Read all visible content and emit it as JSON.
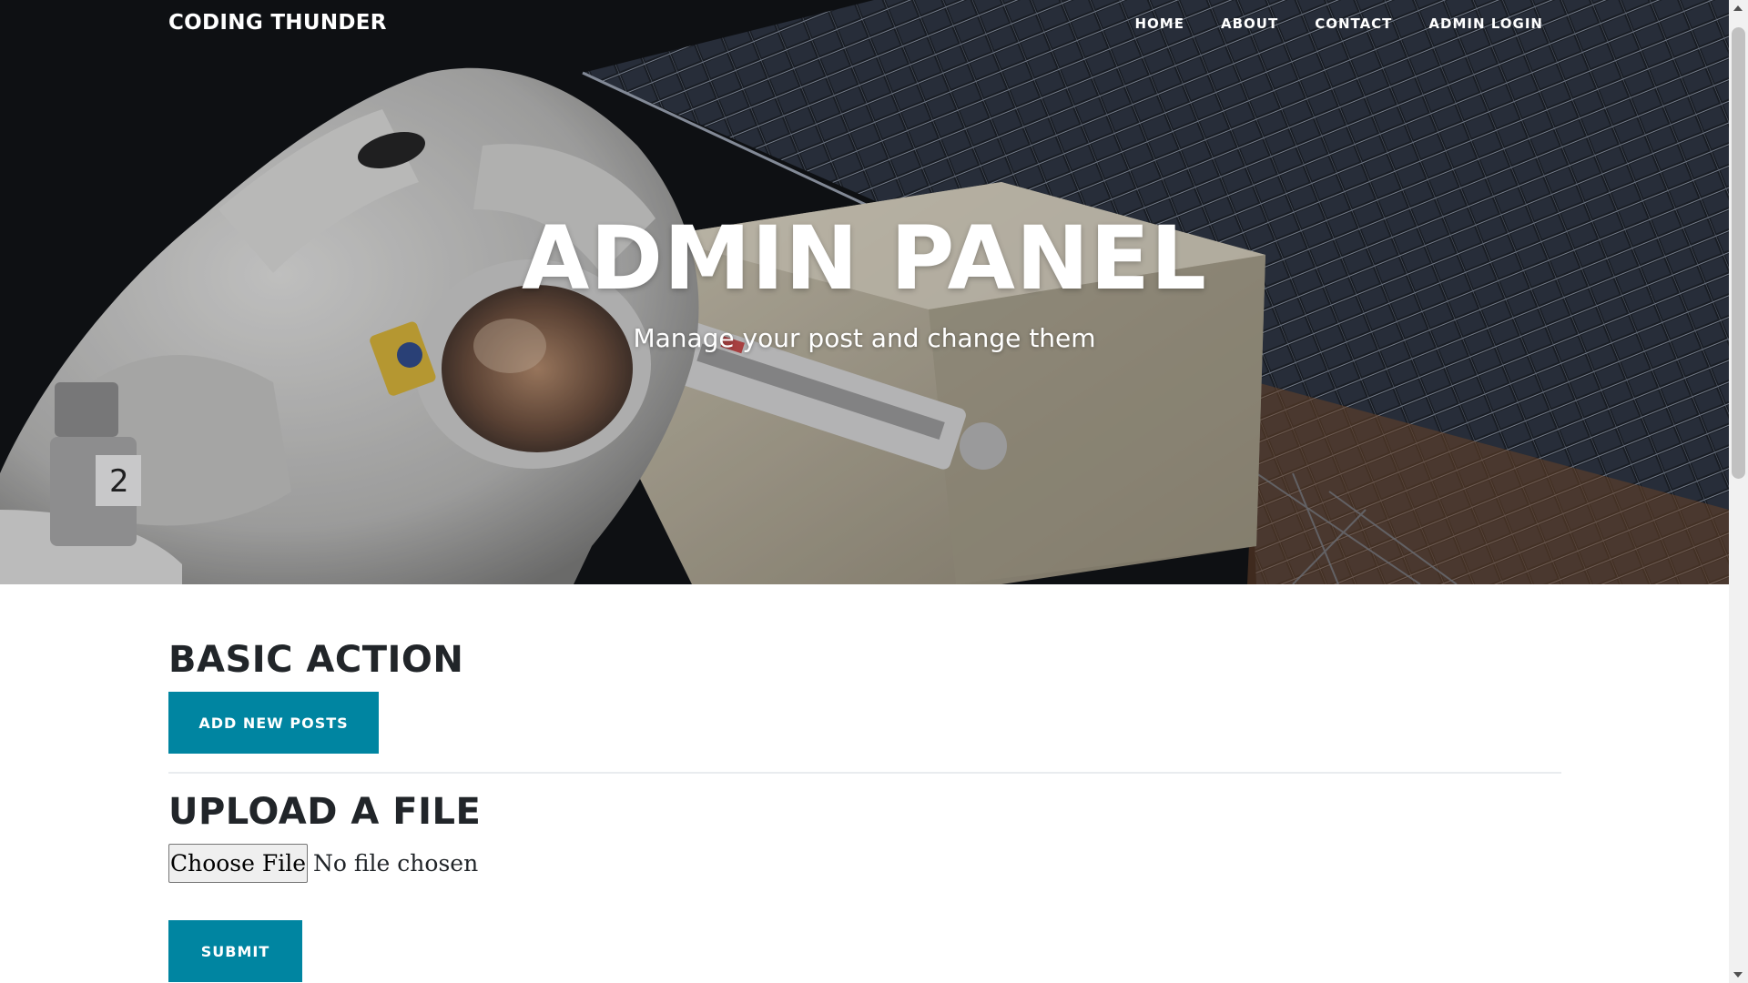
{
  "navbar": {
    "brand": "CODING THUNDER",
    "links": [
      {
        "label": "HOME"
      },
      {
        "label": "ABOUT"
      },
      {
        "label": "CONTACT"
      },
      {
        "label": "ADMIN LOGIN"
      }
    ]
  },
  "hero": {
    "title": "ADMIN PANEL",
    "subtitle": "Manage your post and change them"
  },
  "main": {
    "basic_heading": "BASIC ACTION",
    "add_posts_label": "ADD NEW POSTS",
    "upload_heading": "UPLOAD A FILE",
    "choose_file_label": "Choose File",
    "file_status": "No file chosen",
    "submit_label": "SUBMIT"
  },
  "colors": {
    "accent": "#0085a1",
    "heading": "#212529",
    "divider": "#e9ecef"
  },
  "icons": {
    "scroll_up": "scroll-up-arrow-icon",
    "scroll_down": "scroll-down-arrow-icon"
  }
}
